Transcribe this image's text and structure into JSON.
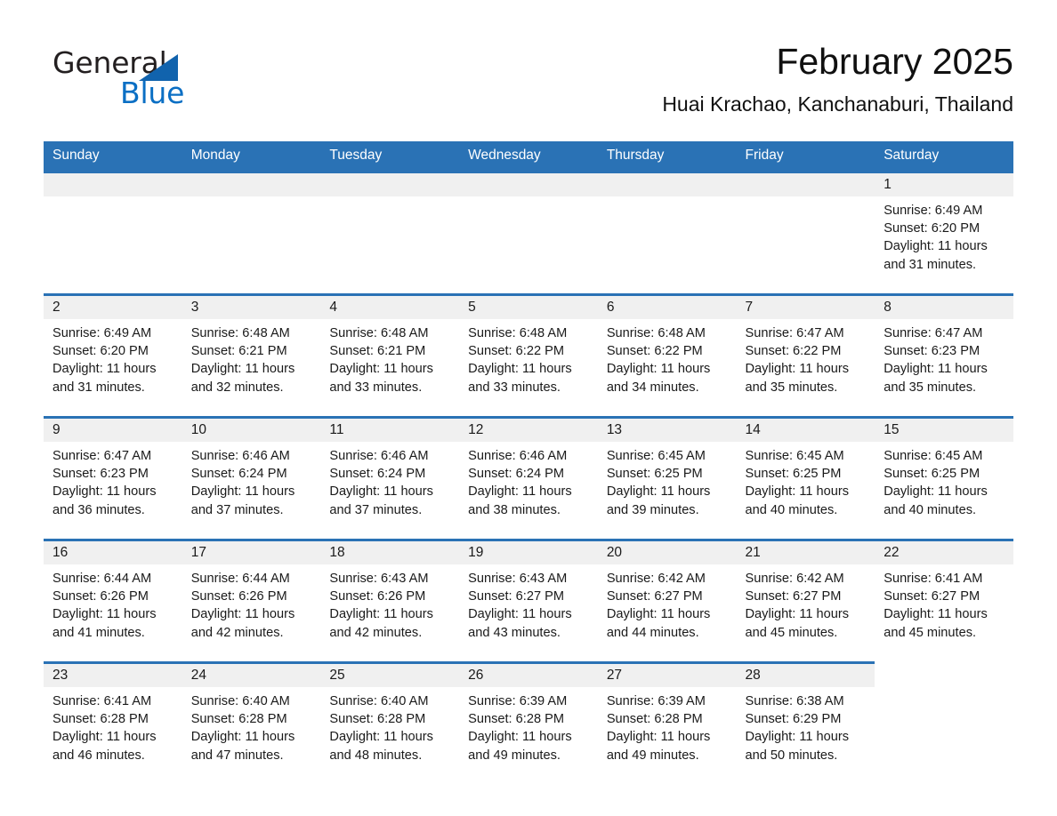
{
  "brand": {
    "name_part1": "General",
    "name_part2": "Blue",
    "triangle_icon": "triangle-icon",
    "accent_color": "#0b6fc4"
  },
  "header": {
    "title": "February 2025",
    "subtitle": "Huai Krachao, Kanchanaburi, Thailand"
  },
  "colors": {
    "header_blue": "#2a72b5",
    "row_rule_blue": "#2a72b5",
    "daynum_band": "#f0f0f0",
    "text": "#1a1a1a"
  },
  "calendar": {
    "weekdays": [
      "Sunday",
      "Monday",
      "Tuesday",
      "Wednesday",
      "Thursday",
      "Friday",
      "Saturday"
    ],
    "weeks": [
      {
        "days": [
          {
            "num": "",
            "sunrise": "",
            "sunset": "",
            "daylight_line1": "",
            "daylight_line2": ""
          },
          {
            "num": "",
            "sunrise": "",
            "sunset": "",
            "daylight_line1": "",
            "daylight_line2": ""
          },
          {
            "num": "",
            "sunrise": "",
            "sunset": "",
            "daylight_line1": "",
            "daylight_line2": ""
          },
          {
            "num": "",
            "sunrise": "",
            "sunset": "",
            "daylight_line1": "",
            "daylight_line2": ""
          },
          {
            "num": "",
            "sunrise": "",
            "sunset": "",
            "daylight_line1": "",
            "daylight_line2": ""
          },
          {
            "num": "",
            "sunrise": "",
            "sunset": "",
            "daylight_line1": "",
            "daylight_line2": ""
          },
          {
            "num": "1",
            "sunrise": "Sunrise: 6:49 AM",
            "sunset": "Sunset: 6:20 PM",
            "daylight_line1": "Daylight: 11 hours",
            "daylight_line2": "and 31 minutes."
          }
        ]
      },
      {
        "days": [
          {
            "num": "2",
            "sunrise": "Sunrise: 6:49 AM",
            "sunset": "Sunset: 6:20 PM",
            "daylight_line1": "Daylight: 11 hours",
            "daylight_line2": "and 31 minutes."
          },
          {
            "num": "3",
            "sunrise": "Sunrise: 6:48 AM",
            "sunset": "Sunset: 6:21 PM",
            "daylight_line1": "Daylight: 11 hours",
            "daylight_line2": "and 32 minutes."
          },
          {
            "num": "4",
            "sunrise": "Sunrise: 6:48 AM",
            "sunset": "Sunset: 6:21 PM",
            "daylight_line1": "Daylight: 11 hours",
            "daylight_line2": "and 33 minutes."
          },
          {
            "num": "5",
            "sunrise": "Sunrise: 6:48 AM",
            "sunset": "Sunset: 6:22 PM",
            "daylight_line1": "Daylight: 11 hours",
            "daylight_line2": "and 33 minutes."
          },
          {
            "num": "6",
            "sunrise": "Sunrise: 6:48 AM",
            "sunset": "Sunset: 6:22 PM",
            "daylight_line1": "Daylight: 11 hours",
            "daylight_line2": "and 34 minutes."
          },
          {
            "num": "7",
            "sunrise": "Sunrise: 6:47 AM",
            "sunset": "Sunset: 6:22 PM",
            "daylight_line1": "Daylight: 11 hours",
            "daylight_line2": "and 35 minutes."
          },
          {
            "num": "8",
            "sunrise": "Sunrise: 6:47 AM",
            "sunset": "Sunset: 6:23 PM",
            "daylight_line1": "Daylight: 11 hours",
            "daylight_line2": "and 35 minutes."
          }
        ]
      },
      {
        "days": [
          {
            "num": "9",
            "sunrise": "Sunrise: 6:47 AM",
            "sunset": "Sunset: 6:23 PM",
            "daylight_line1": "Daylight: 11 hours",
            "daylight_line2": "and 36 minutes."
          },
          {
            "num": "10",
            "sunrise": "Sunrise: 6:46 AM",
            "sunset": "Sunset: 6:24 PM",
            "daylight_line1": "Daylight: 11 hours",
            "daylight_line2": "and 37 minutes."
          },
          {
            "num": "11",
            "sunrise": "Sunrise: 6:46 AM",
            "sunset": "Sunset: 6:24 PM",
            "daylight_line1": "Daylight: 11 hours",
            "daylight_line2": "and 37 minutes."
          },
          {
            "num": "12",
            "sunrise": "Sunrise: 6:46 AM",
            "sunset": "Sunset: 6:24 PM",
            "daylight_line1": "Daylight: 11 hours",
            "daylight_line2": "and 38 minutes."
          },
          {
            "num": "13",
            "sunrise": "Sunrise: 6:45 AM",
            "sunset": "Sunset: 6:25 PM",
            "daylight_line1": "Daylight: 11 hours",
            "daylight_line2": "and 39 minutes."
          },
          {
            "num": "14",
            "sunrise": "Sunrise: 6:45 AM",
            "sunset": "Sunset: 6:25 PM",
            "daylight_line1": "Daylight: 11 hours",
            "daylight_line2": "and 40 minutes."
          },
          {
            "num": "15",
            "sunrise": "Sunrise: 6:45 AM",
            "sunset": "Sunset: 6:25 PM",
            "daylight_line1": "Daylight: 11 hours",
            "daylight_line2": "and 40 minutes."
          }
        ]
      },
      {
        "days": [
          {
            "num": "16",
            "sunrise": "Sunrise: 6:44 AM",
            "sunset": "Sunset: 6:26 PM",
            "daylight_line1": "Daylight: 11 hours",
            "daylight_line2": "and 41 minutes."
          },
          {
            "num": "17",
            "sunrise": "Sunrise: 6:44 AM",
            "sunset": "Sunset: 6:26 PM",
            "daylight_line1": "Daylight: 11 hours",
            "daylight_line2": "and 42 minutes."
          },
          {
            "num": "18",
            "sunrise": "Sunrise: 6:43 AM",
            "sunset": "Sunset: 6:26 PM",
            "daylight_line1": "Daylight: 11 hours",
            "daylight_line2": "and 42 minutes."
          },
          {
            "num": "19",
            "sunrise": "Sunrise: 6:43 AM",
            "sunset": "Sunset: 6:27 PM",
            "daylight_line1": "Daylight: 11 hours",
            "daylight_line2": "and 43 minutes."
          },
          {
            "num": "20",
            "sunrise": "Sunrise: 6:42 AM",
            "sunset": "Sunset: 6:27 PM",
            "daylight_line1": "Daylight: 11 hours",
            "daylight_line2": "and 44 minutes."
          },
          {
            "num": "21",
            "sunrise": "Sunrise: 6:42 AM",
            "sunset": "Sunset: 6:27 PM",
            "daylight_line1": "Daylight: 11 hours",
            "daylight_line2": "and 45 minutes."
          },
          {
            "num": "22",
            "sunrise": "Sunrise: 6:41 AM",
            "sunset": "Sunset: 6:27 PM",
            "daylight_line1": "Daylight: 11 hours",
            "daylight_line2": "and 45 minutes."
          }
        ]
      },
      {
        "days": [
          {
            "num": "23",
            "sunrise": "Sunrise: 6:41 AM",
            "sunset": "Sunset: 6:28 PM",
            "daylight_line1": "Daylight: 11 hours",
            "daylight_line2": "and 46 minutes."
          },
          {
            "num": "24",
            "sunrise": "Sunrise: 6:40 AM",
            "sunset": "Sunset: 6:28 PM",
            "daylight_line1": "Daylight: 11 hours",
            "daylight_line2": "and 47 minutes."
          },
          {
            "num": "25",
            "sunrise": "Sunrise: 6:40 AM",
            "sunset": "Sunset: 6:28 PM",
            "daylight_line1": "Daylight: 11 hours",
            "daylight_line2": "and 48 minutes."
          },
          {
            "num": "26",
            "sunrise": "Sunrise: 6:39 AM",
            "sunset": "Sunset: 6:28 PM",
            "daylight_line1": "Daylight: 11 hours",
            "daylight_line2": "and 49 minutes."
          },
          {
            "num": "27",
            "sunrise": "Sunrise: 6:39 AM",
            "sunset": "Sunset: 6:28 PM",
            "daylight_line1": "Daylight: 11 hours",
            "daylight_line2": "and 49 minutes."
          },
          {
            "num": "28",
            "sunrise": "Sunrise: 6:38 AM",
            "sunset": "Sunset: 6:29 PM",
            "daylight_line1": "Daylight: 11 hours",
            "daylight_line2": "and 50 minutes."
          },
          {
            "num": "",
            "sunrise": "",
            "sunset": "",
            "daylight_line1": "",
            "daylight_line2": ""
          }
        ]
      }
    ]
  }
}
